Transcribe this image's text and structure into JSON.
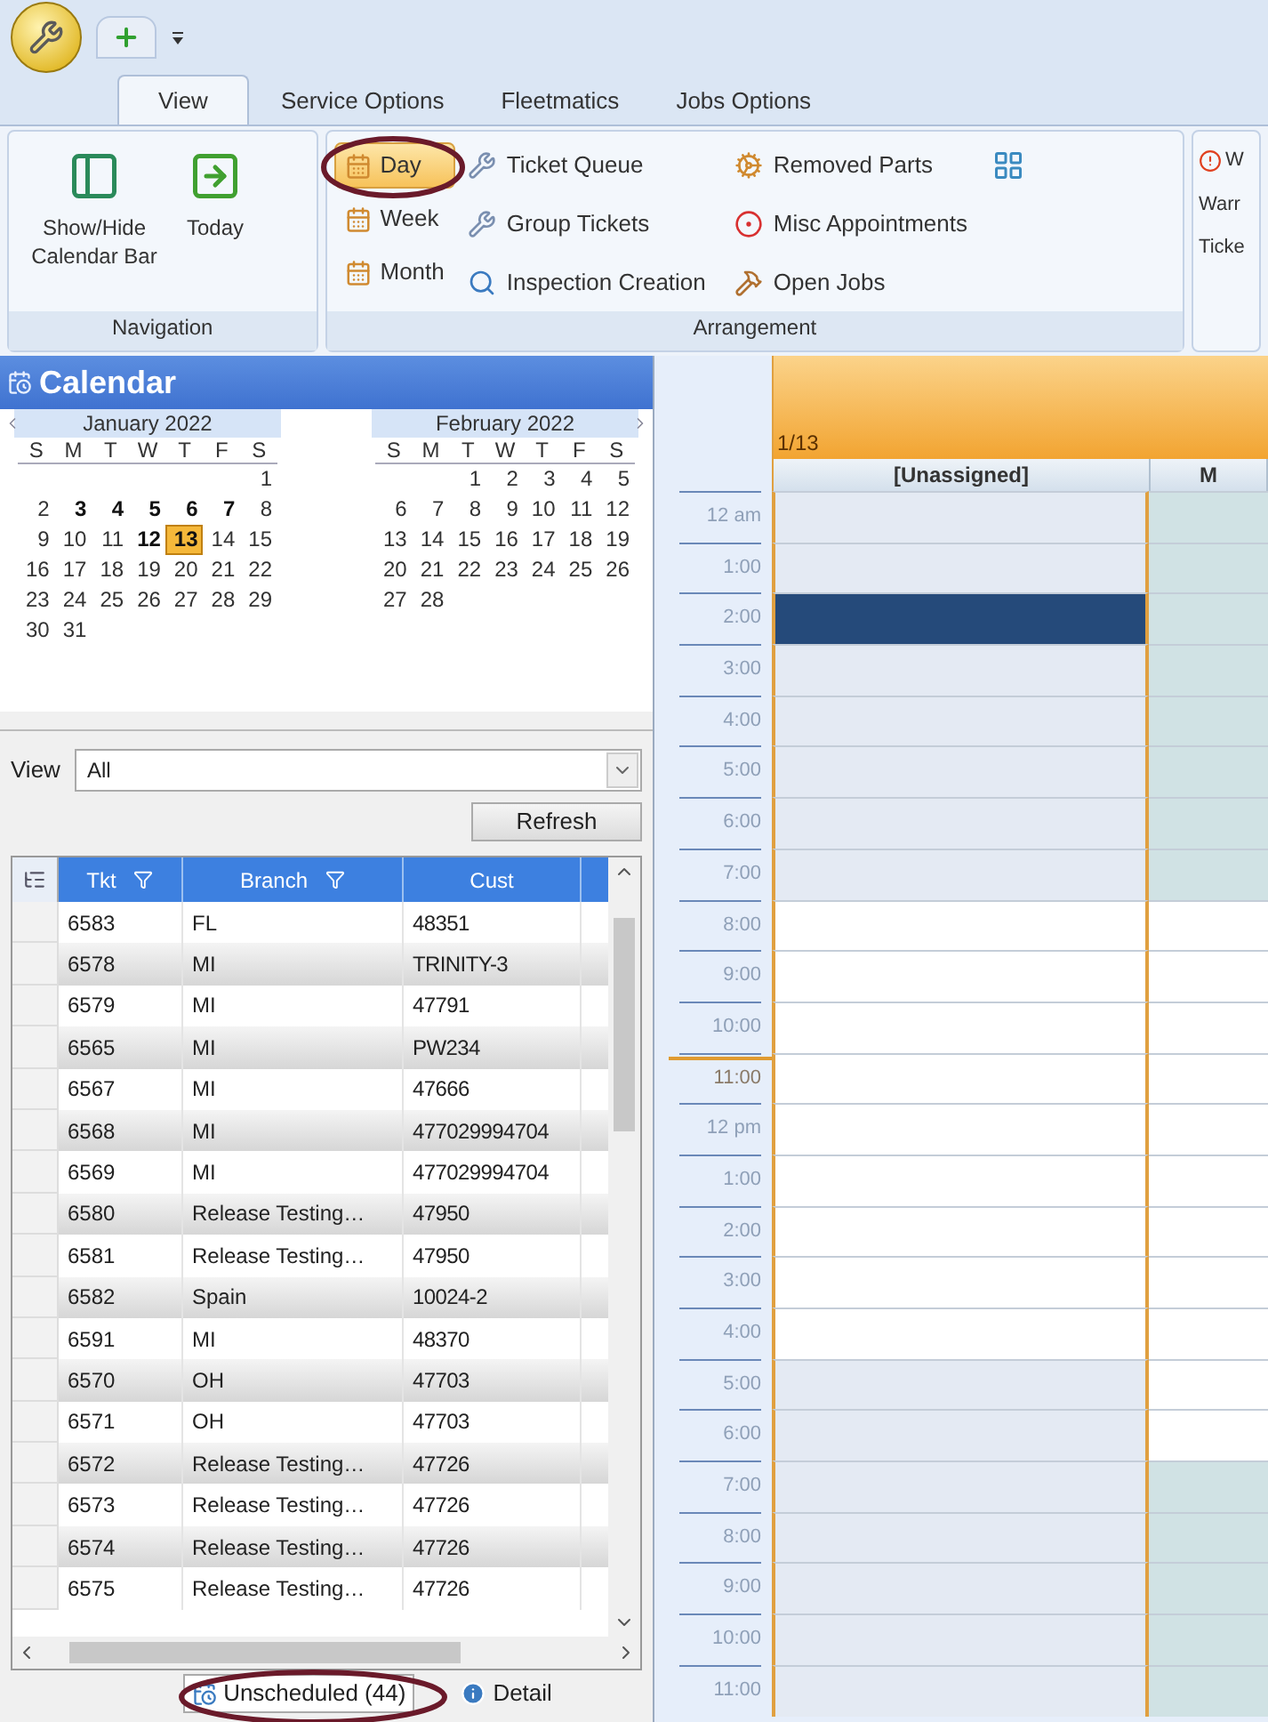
{
  "ribbon": {
    "tabs": [
      {
        "label": "View",
        "selected": true
      },
      {
        "label": "Service Options",
        "selected": false
      },
      {
        "label": "Fleetmatics",
        "selected": false
      },
      {
        "label": "Jobs Options",
        "selected": false
      }
    ],
    "navigation": {
      "label": "Navigation",
      "buttons": [
        "Show/Hide Calendar Bar",
        "Today"
      ]
    },
    "arrangement": {
      "label": "Arrangement",
      "views": [
        {
          "label": "Day",
          "selected": true
        },
        {
          "label": "Week",
          "selected": false
        },
        {
          "label": "Month",
          "selected": false
        }
      ],
      "commands": [
        "Ticket Queue",
        "Group Tickets",
        "Inspection Creation",
        "Removed Parts",
        "Misc Appointments",
        "Open Jobs"
      ]
    },
    "cut_group": {
      "items": [
        "W",
        "Warr",
        "Ticke"
      ]
    }
  },
  "calendar_panel": {
    "title": "Calendar",
    "months": [
      {
        "title": "January 2022",
        "weekdays": [
          "S",
          "M",
          "T",
          "W",
          "T",
          "F",
          "S"
        ],
        "weeks": [
          [
            {
              "t": "1",
              "bold": false,
              "selected": false
            }
          ],
          [
            {
              "t": "2",
              "bold": false,
              "selected": false
            },
            {
              "t": "3",
              "bold": true,
              "selected": false
            },
            {
              "t": "4",
              "bold": true,
              "selected": false
            },
            {
              "t": "5",
              "bold": true,
              "selected": false
            },
            {
              "t": "6",
              "bold": true,
              "selected": false
            },
            {
              "t": "7",
              "bold": true,
              "selected": false
            },
            {
              "t": "8",
              "bold": false,
              "selected": false
            }
          ],
          [
            {
              "t": "9",
              "bold": false,
              "selected": false
            },
            {
              "t": "10",
              "bold": false,
              "selected": false
            },
            {
              "t": "11",
              "bold": false,
              "selected": false
            },
            {
              "t": "12",
              "bold": true,
              "selected": false
            },
            {
              "t": "13",
              "bold": true,
              "selected": true
            },
            {
              "t": "14",
              "bold": false,
              "selected": false
            },
            {
              "t": "15",
              "bold": false,
              "selected": false
            }
          ],
          [
            {
              "t": "16",
              "bold": false,
              "selected": false
            },
            {
              "t": "17",
              "bold": false,
              "selected": false
            },
            {
              "t": "18",
              "bold": false,
              "selected": false
            },
            {
              "t": "19",
              "bold": false,
              "selected": false
            },
            {
              "t": "20",
              "bold": false,
              "selected": false
            },
            {
              "t": "21",
              "bold": false,
              "selected": false
            },
            {
              "t": "22",
              "bold": false,
              "selected": false
            }
          ],
          [
            {
              "t": "23",
              "bold": false,
              "selected": false
            },
            {
              "t": "24",
              "bold": false,
              "selected": false
            },
            {
              "t": "25",
              "bold": false,
              "selected": false
            },
            {
              "t": "26",
              "bold": false,
              "selected": false
            },
            {
              "t": "27",
              "bold": false,
              "selected": false
            },
            {
              "t": "28",
              "bold": false,
              "selected": false
            },
            {
              "t": "29",
              "bold": false,
              "selected": false
            }
          ],
          [
            {
              "t": "30",
              "bold": false,
              "selected": false
            },
            {
              "t": "31",
              "bold": false,
              "selected": false
            }
          ]
        ]
      },
      {
        "title": "February 2022",
        "weekdays": [
          "S",
          "M",
          "T",
          "W",
          "T",
          "F",
          "S"
        ],
        "weeks": [
          [
            {
              "t": "1",
              "bold": false,
              "selected": false
            },
            {
              "t": "2",
              "bold": false,
              "selected": false
            },
            {
              "t": "3",
              "bold": false,
              "selected": false
            },
            {
              "t": "4",
              "bold": false,
              "selected": false
            },
            {
              "t": "5",
              "bold": false,
              "selected": false
            }
          ],
          [
            {
              "t": "6",
              "bold": false,
              "selected": false
            },
            {
              "t": "7",
              "bold": false,
              "selected": false
            },
            {
              "t": "8",
              "bold": false,
              "selected": false
            },
            {
              "t": "9",
              "bold": false,
              "selected": false
            },
            {
              "t": "10",
              "bold": false,
              "selected": false
            },
            {
              "t": "11",
              "bold": false,
              "selected": false
            },
            {
              "t": "12",
              "bold": false,
              "selected": false
            }
          ],
          [
            {
              "t": "13",
              "bold": false,
              "selected": false
            },
            {
              "t": "14",
              "bold": false,
              "selected": false
            },
            {
              "t": "15",
              "bold": false,
              "selected": false
            },
            {
              "t": "16",
              "bold": false,
              "selected": false
            },
            {
              "t": "17",
              "bold": false,
              "selected": false
            },
            {
              "t": "18",
              "bold": false,
              "selected": false
            },
            {
              "t": "19",
              "bold": false,
              "selected": false
            }
          ],
          [
            {
              "t": "20",
              "bold": false,
              "selected": false
            },
            {
              "t": "21",
              "bold": false,
              "selected": false
            },
            {
              "t": "22",
              "bold": false,
              "selected": false
            },
            {
              "t": "23",
              "bold": false,
              "selected": false
            },
            {
              "t": "24",
              "bold": false,
              "selected": false
            },
            {
              "t": "25",
              "bold": false,
              "selected": false
            },
            {
              "t": "26",
              "bold": false,
              "selected": false
            }
          ],
          [
            {
              "t": "27",
              "bold": false,
              "selected": false
            },
            {
              "t": "28",
              "bold": false,
              "selected": false
            }
          ]
        ]
      }
    ],
    "filter": {
      "label": "View",
      "value": "All",
      "button": "Refresh"
    },
    "grid": {
      "columns": [
        {
          "label": "Tkt",
          "filter": true
        },
        {
          "label": "Branch",
          "filter": true
        },
        {
          "label": "Cust",
          "filter": false
        }
      ],
      "rows": [
        [
          "6583",
          "FL",
          "48351"
        ],
        [
          "6578",
          "MI",
          "TRINITY-3"
        ],
        [
          "6579",
          "MI",
          "47791"
        ],
        [
          "6565",
          "MI",
          "PW234"
        ],
        [
          "6567",
          "MI",
          "47666"
        ],
        [
          "6568",
          "MI",
          "477029994704"
        ],
        [
          "6569",
          "MI",
          "477029994704"
        ],
        [
          "6580",
          "Release Testing…",
          "47950"
        ],
        [
          "6581",
          "Release Testing…",
          "47950"
        ],
        [
          "6582",
          "Spain",
          "10024-2"
        ],
        [
          "6591",
          "MI",
          "48370"
        ],
        [
          "6570",
          "OH",
          "47703"
        ],
        [
          "6571",
          "OH",
          "47703"
        ],
        [
          "6572",
          "Release Testing…",
          "47726"
        ],
        [
          "6573",
          "Release Testing…",
          "47726"
        ],
        [
          "6574",
          "Release Testing…",
          "47726"
        ],
        [
          "6575",
          "Release Testing…",
          "47726"
        ]
      ]
    },
    "bottom_tabs": [
      {
        "label": "Unscheduled (44)",
        "selected": true
      },
      {
        "label": "Detail",
        "selected": false
      }
    ]
  },
  "day_view": {
    "date": "1/13",
    "resources": [
      "[Unassigned]",
      "M"
    ],
    "hours": [
      {
        "label": "12 am",
        "now": false,
        "cells": [
          {
            "working": false,
            "selected": false
          },
          {
            "working": false,
            "selected": false
          }
        ]
      },
      {
        "label": "1:00",
        "now": false,
        "cells": [
          {
            "working": false,
            "selected": false
          },
          {
            "working": false,
            "selected": false
          }
        ]
      },
      {
        "label": "2:00",
        "now": false,
        "cells": [
          {
            "working": false,
            "selected": true
          },
          {
            "working": false,
            "selected": false
          }
        ]
      },
      {
        "label": "3:00",
        "now": false,
        "cells": [
          {
            "working": false,
            "selected": false
          },
          {
            "working": false,
            "selected": false
          }
        ]
      },
      {
        "label": "4:00",
        "now": false,
        "cells": [
          {
            "working": false,
            "selected": false
          },
          {
            "working": false,
            "selected": false
          }
        ]
      },
      {
        "label": "5:00",
        "now": false,
        "cells": [
          {
            "working": false,
            "selected": false
          },
          {
            "working": false,
            "selected": false
          }
        ]
      },
      {
        "label": "6:00",
        "now": false,
        "cells": [
          {
            "working": false,
            "selected": false
          },
          {
            "working": false,
            "selected": false
          }
        ]
      },
      {
        "label": "7:00",
        "now": false,
        "cells": [
          {
            "working": false,
            "selected": false
          },
          {
            "working": false,
            "selected": false
          }
        ]
      },
      {
        "label": "8:00",
        "now": false,
        "cells": [
          {
            "working": true,
            "selected": false
          },
          {
            "working": true,
            "selected": false
          }
        ]
      },
      {
        "label": "9:00",
        "now": false,
        "cells": [
          {
            "working": true,
            "selected": false
          },
          {
            "working": true,
            "selected": false
          }
        ]
      },
      {
        "label": "10:00",
        "now": false,
        "cells": [
          {
            "working": true,
            "selected": false
          },
          {
            "working": true,
            "selected": false
          }
        ]
      },
      {
        "label": "11:00",
        "now": true,
        "cells": [
          {
            "working": true,
            "selected": false
          },
          {
            "working": true,
            "selected": false
          }
        ]
      },
      {
        "label": "12 pm",
        "now": false,
        "cells": [
          {
            "working": true,
            "selected": false
          },
          {
            "working": true,
            "selected": false
          }
        ]
      },
      {
        "label": "1:00",
        "now": false,
        "cells": [
          {
            "working": true,
            "selected": false
          },
          {
            "working": true,
            "selected": false
          }
        ]
      },
      {
        "label": "2:00",
        "now": false,
        "cells": [
          {
            "working": true,
            "selected": false
          },
          {
            "working": true,
            "selected": false
          }
        ]
      },
      {
        "label": "3:00",
        "now": false,
        "cells": [
          {
            "working": true,
            "selected": false
          },
          {
            "working": true,
            "selected": false
          }
        ]
      },
      {
        "label": "4:00",
        "now": false,
        "cells": [
          {
            "working": true,
            "selected": false
          },
          {
            "working": true,
            "selected": false
          }
        ]
      },
      {
        "label": "5:00",
        "now": false,
        "cells": [
          {
            "working": false,
            "selected": false
          },
          {
            "working": true,
            "selected": false
          }
        ]
      },
      {
        "label": "6:00",
        "now": false,
        "cells": [
          {
            "working": false,
            "selected": false
          },
          {
            "working": true,
            "selected": false
          }
        ]
      },
      {
        "label": "7:00",
        "now": false,
        "cells": [
          {
            "working": false,
            "selected": false
          },
          {
            "working": false,
            "selected": false
          }
        ]
      },
      {
        "label": "8:00",
        "now": false,
        "cells": [
          {
            "working": false,
            "selected": false
          },
          {
            "working": false,
            "selected": false
          }
        ]
      },
      {
        "label": "9:00",
        "now": false,
        "cells": [
          {
            "working": false,
            "selected": false
          },
          {
            "working": false,
            "selected": false
          }
        ]
      },
      {
        "label": "10:00",
        "now": false,
        "cells": [
          {
            "working": false,
            "selected": false
          },
          {
            "working": false,
            "selected": false
          }
        ]
      },
      {
        "label": "11:00",
        "now": false,
        "cells": [
          {
            "working": false,
            "selected": false
          },
          {
            "working": false,
            "selected": false
          }
        ]
      }
    ]
  }
}
